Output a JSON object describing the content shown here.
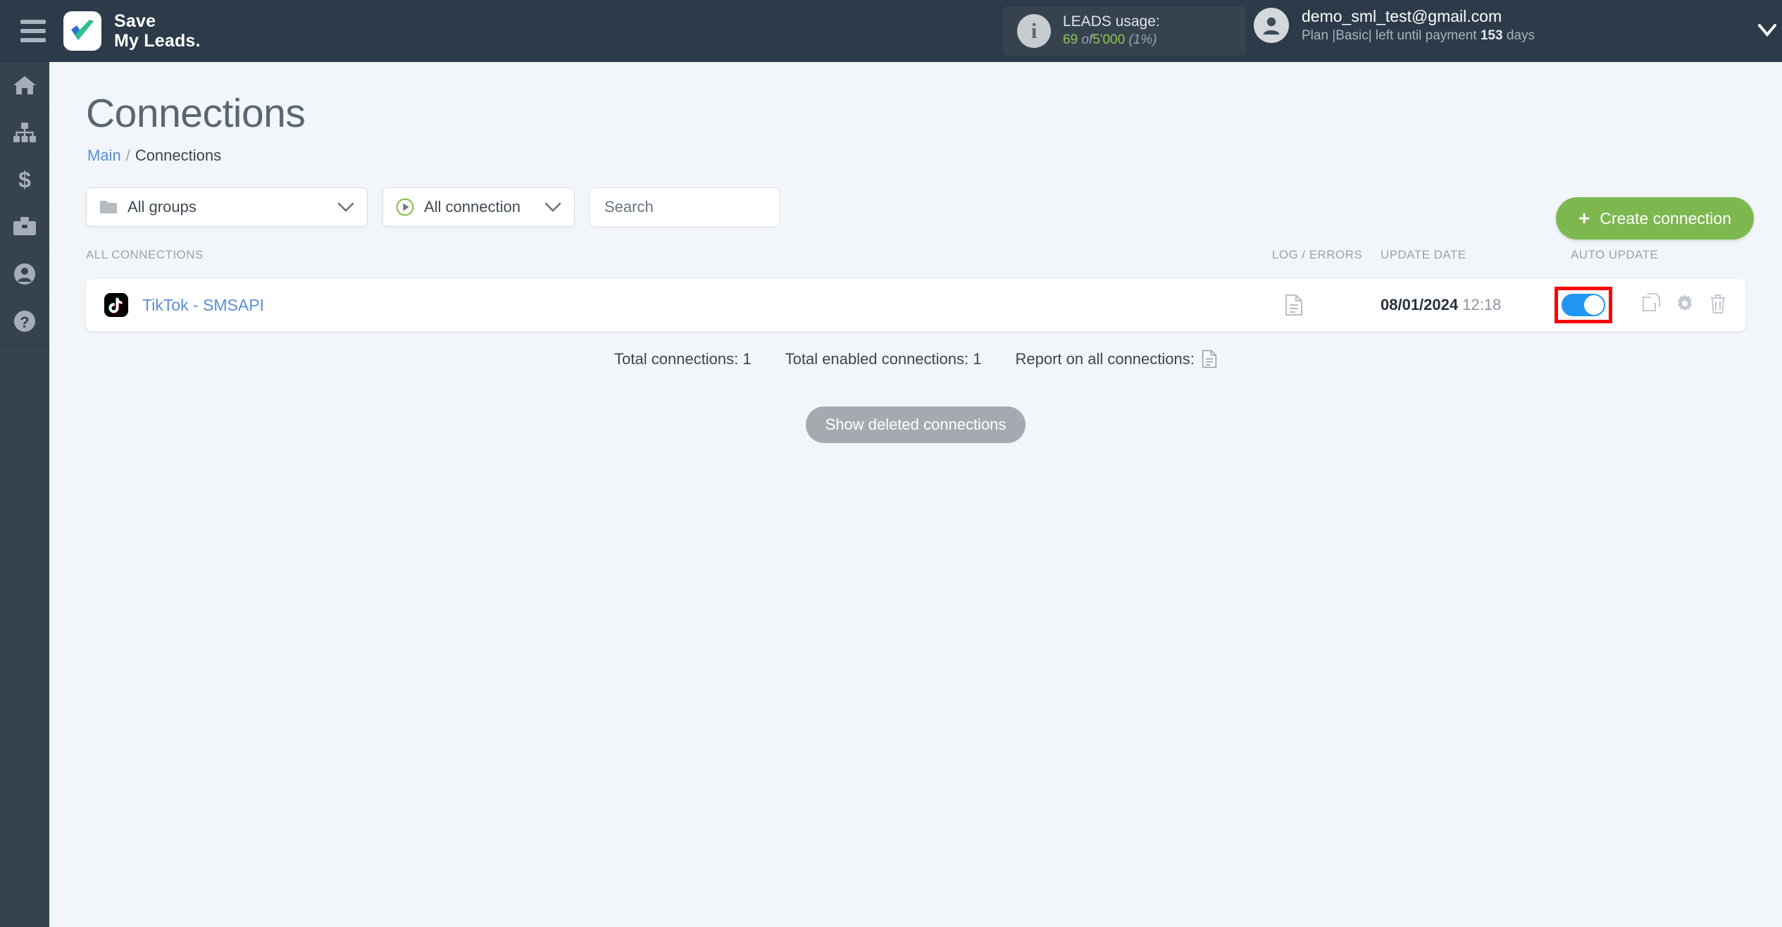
{
  "brand": {
    "line1": "Save",
    "line2": "My Leads.",
    "logo_icon": "checkmark-logo"
  },
  "topbar": {
    "menu_icon": "hamburger-icon",
    "leads": {
      "info_icon": "info-icon",
      "title": "LEADS usage:",
      "used": "69",
      "of": "of",
      "total": "5'000",
      "percent": "(1%)"
    },
    "user": {
      "avatar_icon": "user-avatar-icon",
      "email": "demo_sml_test@gmail.com",
      "plan_prefix": "Plan |Basic| left until payment",
      "days_value": "153",
      "days_suffix": "days",
      "chevron_icon": "chevron-down-icon"
    }
  },
  "sidebar": {
    "items": [
      {
        "name": "home",
        "icon": "home-icon"
      },
      {
        "name": "connections",
        "icon": "sitemap-icon"
      },
      {
        "name": "billing",
        "icon": "dollar-icon"
      },
      {
        "name": "business",
        "icon": "briefcase-icon"
      },
      {
        "name": "account",
        "icon": "user-circle-icon"
      },
      {
        "name": "help",
        "icon": "question-circle-icon"
      }
    ]
  },
  "page": {
    "title": "Connections",
    "breadcrumb": {
      "root": "Main",
      "separator": "/",
      "current": "Connections"
    }
  },
  "filters": {
    "groups": {
      "label": "All groups",
      "icon": "folder-icon",
      "chevron": "chevron-down-icon"
    },
    "connection": {
      "label": "All connection",
      "icon": "play-circle-icon",
      "chevron": "chevron-down-icon"
    },
    "search": {
      "placeholder": "Search",
      "value": ""
    }
  },
  "actions": {
    "create_label": "Create connection",
    "create_icon": "plus-icon"
  },
  "table": {
    "headers": {
      "all_connections": "ALL CONNECTIONS",
      "log_errors": "LOG / ERRORS",
      "update_date": "UPDATE DATE",
      "auto_update": "AUTO UPDATE"
    },
    "rows": [
      {
        "service_icon": "tiktok-icon",
        "name": "TikTok - SMSAPI",
        "log_icon": "document-icon",
        "date": "08/01/2024",
        "time": "12:18",
        "auto_update_on": true,
        "copy_icon": "copy-icon",
        "settings_icon": "gear-icon",
        "delete_icon": "trash-icon"
      }
    ]
  },
  "footer": {
    "total_connections": "Total connections: 1",
    "total_enabled": "Total enabled connections: 1",
    "report_label": "Report on all connections:",
    "report_icon": "document-icon",
    "show_deleted": "Show deleted connections"
  },
  "colors": {
    "topbar_bg": "#2c3a49",
    "sidebar_bg": "#36434f",
    "page_bg": "#f2f5fa",
    "link_blue": "#5b8fd6",
    "accent_green": "#7db84f",
    "toggle_blue": "#2196f3",
    "highlight_red": "#ff0000",
    "leads_green": "#8fc44e"
  }
}
